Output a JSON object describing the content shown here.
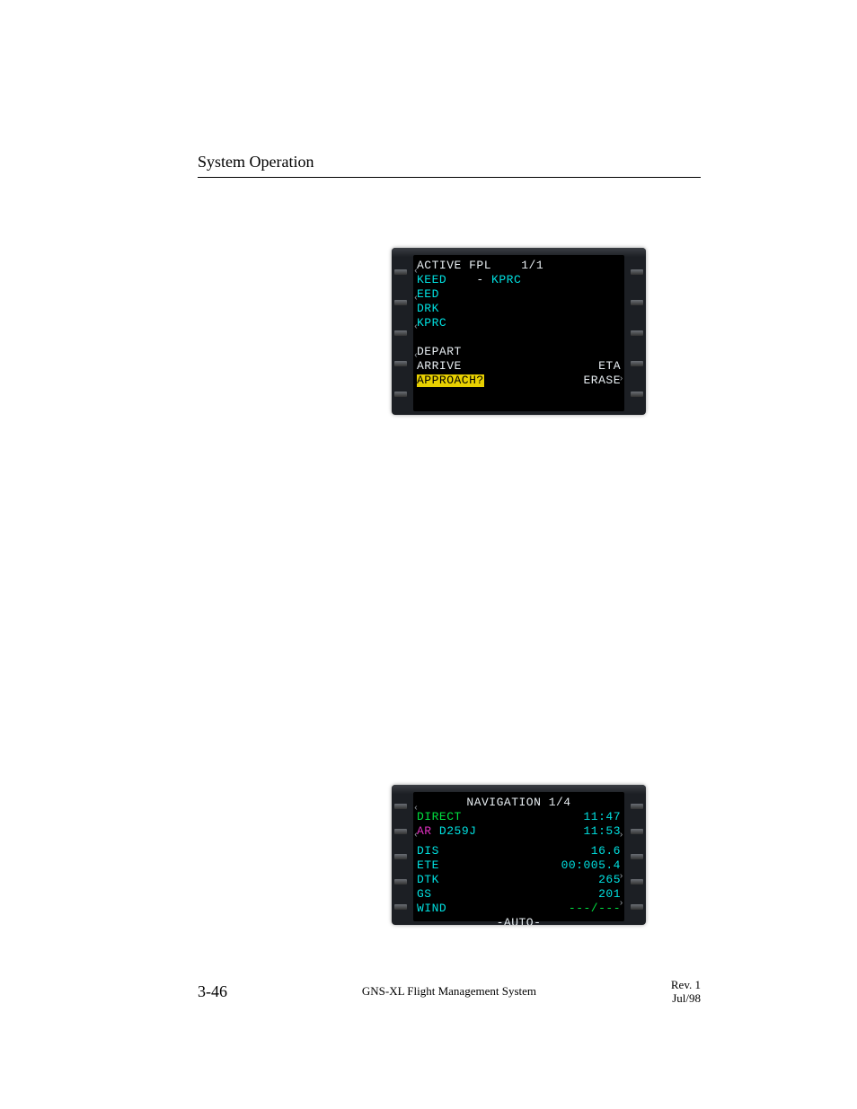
{
  "header": {
    "title": "System Operation"
  },
  "footer": {
    "page_num": "3-46",
    "center": "GNS-XL Flight Management System",
    "rev_line1": "Rev. 1",
    "rev_line2": "Jul/98"
  },
  "cdu1": {
    "title_left": "ACTIVE FPL",
    "title_right": "1/1",
    "route_from": "KEED",
    "route_dash": "    -",
    "route_to": " KPRC",
    "wpts": [
      "EED",
      "DRK",
      "KPRC"
    ],
    "softkeys_left": [
      "DEPART",
      "ARRIVE",
      "APPROACH?"
    ],
    "softkeys_right": [
      "ETA",
      "ERASE"
    ],
    "highlight_index": 2
  },
  "cdu2": {
    "title": "NAVIGATION 1/4",
    "direct_label": "DIRECT",
    "direct_time": "11:47",
    "ar_label": "AR",
    "ar_wpt": " D259J",
    "ar_time": "11:53",
    "fields": [
      {
        "label": "DIS",
        "value": "16.6"
      },
      {
        "label": "ETE",
        "value": "00:005.4"
      },
      {
        "label": "DTK",
        "value": "265"
      },
      {
        "label": "GS",
        "value": "201"
      },
      {
        "label": "WIND",
        "value": "---/---"
      }
    ],
    "mode": "-AUTO-"
  }
}
